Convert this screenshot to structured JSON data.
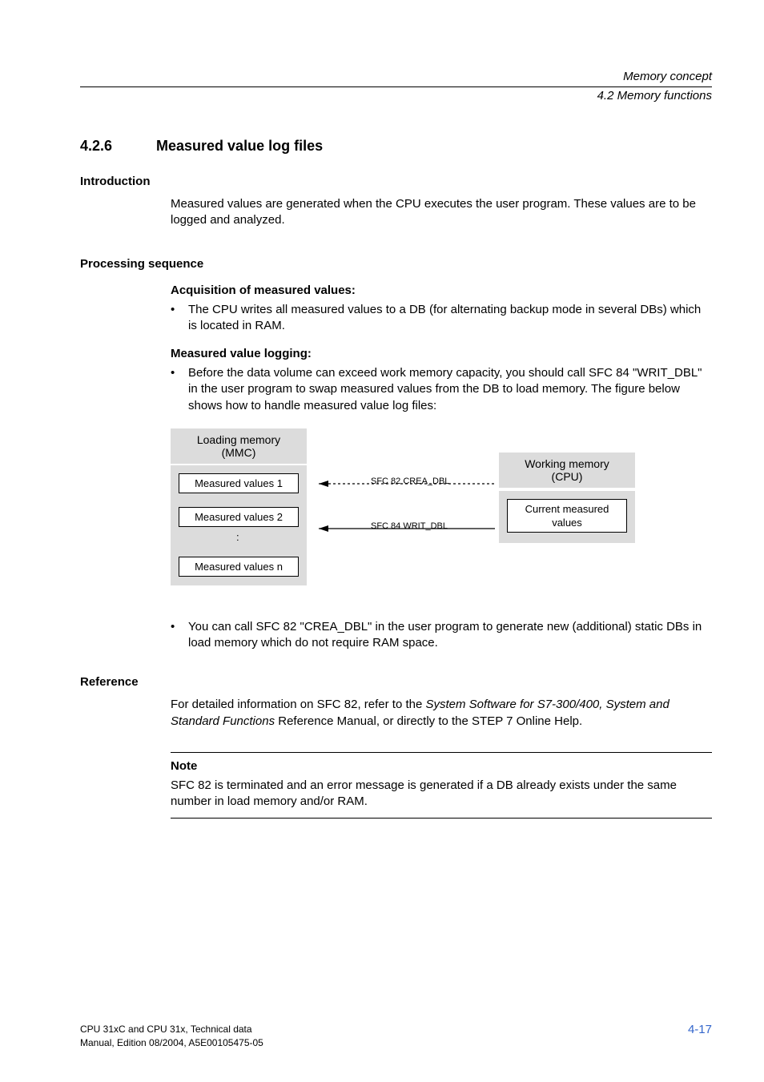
{
  "header": {
    "chapter_title": "Memory concept",
    "section_title": "4.2 Memory functions"
  },
  "section": {
    "number": "4.2.6",
    "title": "Measured value log files"
  },
  "intro": {
    "heading": "Introduction",
    "text": "Measured values are generated when the CPU executes the user program. These values are to be logged and analyzed."
  },
  "proc": {
    "heading": "Processing sequence",
    "acq_heading": "Acquisition of measured values:",
    "acq_bullet": "The CPU writes all measured values to a DB (for alternating backup mode in several DBs) which is located in RAM.",
    "log_heading": "Measured value logging:",
    "log_bullet": "Before the data volume can exceed work memory capacity, you should call SFC 84 \"WRIT_DBL\" in the user program to swap measured values from the DB to load memory. The figure below shows how to handle measured value log files:",
    "post_diagram_bullet": "You can call SFC 82 \"CREA_DBL\" in the user program to generate new (additional) static DBs in load memory which do not require RAM space."
  },
  "diagram": {
    "loading_mem_l1": "Loading memory",
    "loading_mem_l2": "(MMC)",
    "mv1": "Measured values 1",
    "mv2": "Measured values 2",
    "mvn": "Measured values n",
    "sfc82": "SFC 82 CREA_DBL",
    "sfc84": "SFC 84 WRIT_DBL",
    "working_mem_l1": "Working memory",
    "working_mem_l2": "(CPU)",
    "current_l1": "Current measured",
    "current_l2": "values",
    "colon": ":"
  },
  "reference": {
    "heading": "Reference",
    "pre": "For detailed information on SFC 82, refer to the ",
    "italic": "System Software for S7-300/400, System and Standard Functions",
    "post": " Reference Manual, or directly to the STEP 7 Online Help."
  },
  "note": {
    "title": "Note",
    "body": "SFC 82 is terminated and an error message is generated if a DB already exists under the same number in load memory and/or RAM."
  },
  "footer": {
    "line1": "CPU 31xC and CPU 31x, Technical data",
    "line2": "Manual, Edition 08/2004, A5E00105475-05",
    "page": "4-17"
  }
}
